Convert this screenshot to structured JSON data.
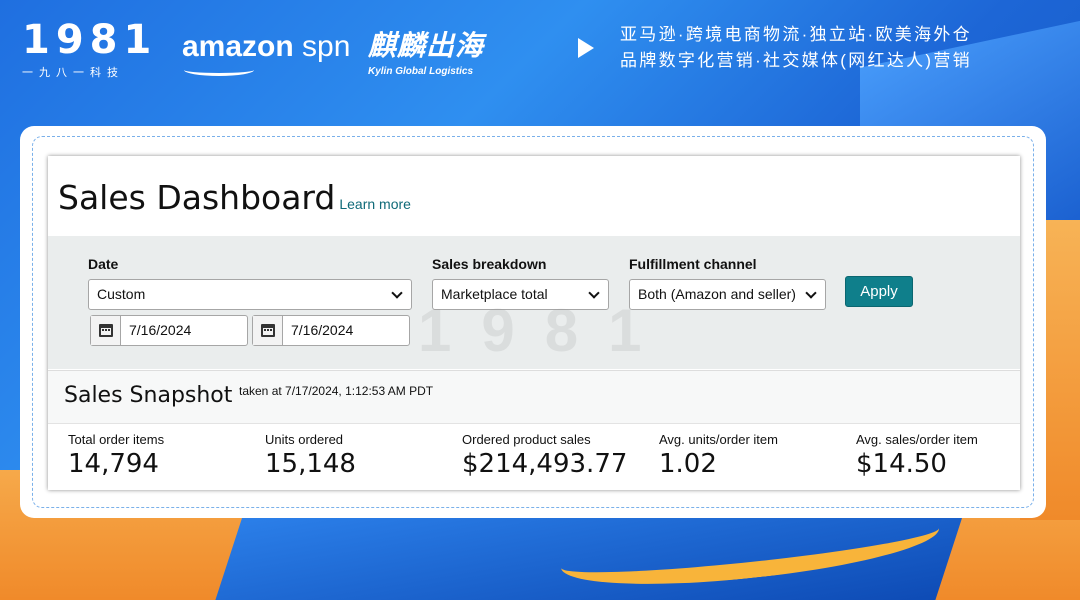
{
  "header": {
    "logo_digits": "1981",
    "logo_sub": "一九八一科技",
    "amazon_word": "amazon",
    "spn_word": "spn",
    "kylin_cn": "麒麟出海",
    "kylin_en": "Kylin Global Logistics",
    "tagline_line1": "亚马逊·跨境电商物流·独立站·欧美海外仓",
    "tagline_line2": "品牌数字化营销·社交媒体(网红达人)营销"
  },
  "dashboard": {
    "title": "Sales Dashboard",
    "learn_more": "Learn more",
    "date_label": "Date",
    "date_select": "Custom",
    "date_from": "7/16/2024",
    "date_to": "7/16/2024",
    "breakdown_label": "Sales breakdown",
    "breakdown_select": "Marketplace total",
    "fulfillment_label": "Fulfillment channel",
    "fulfillment_select": "Both (Amazon and seller)",
    "apply": "Apply"
  },
  "snapshot": {
    "title": "Sales Snapshot",
    "taken_at": "taken at 7/17/2024, 1:12:53 AM PDT",
    "metrics": [
      {
        "label": "Total order items",
        "value": "14,794"
      },
      {
        "label": "Units ordered",
        "value": "15,148"
      },
      {
        "label": "Ordered product sales",
        "value": "$214,493.77"
      },
      {
        "label": "Avg. units/order item",
        "value": "1.02"
      },
      {
        "label": "Avg. sales/order item",
        "value": "$14.50"
      }
    ]
  },
  "watermark": "1981"
}
